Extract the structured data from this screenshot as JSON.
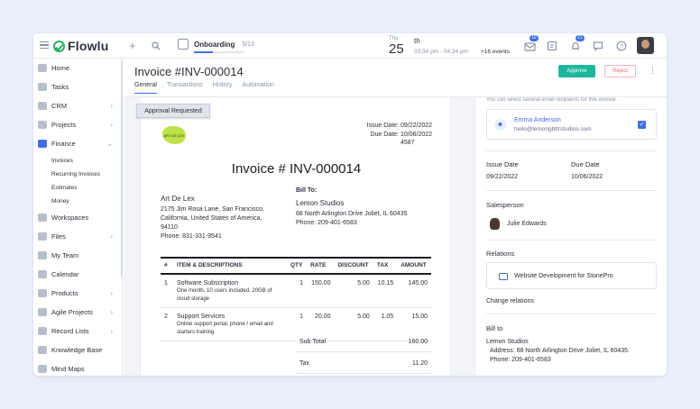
{
  "app": {
    "name": "Flowlu"
  },
  "topbar": {
    "onboarding_label": "Onboarding",
    "onboarding_count": "5/13",
    "onboarding_progress": 0.38,
    "date_dow": "Thu",
    "date_day": "25",
    "date_suffix": "th",
    "date_time": "03:34 pm - 04:34 pm",
    "date_events": "+16 events",
    "mail_badge": "10",
    "bell_badge": "21",
    "icons": [
      "plus-icon",
      "search-icon",
      "mail-icon",
      "notes-icon",
      "bell-icon",
      "chat-icon",
      "help-icon"
    ]
  },
  "sidebar": {
    "items": [
      {
        "label": "Home",
        "chevron": false
      },
      {
        "label": "Tasks",
        "chevron": false
      },
      {
        "label": "CRM",
        "chevron": true
      },
      {
        "label": "Projects",
        "chevron": true
      },
      {
        "label": "Finance",
        "chevron": true,
        "active": true
      },
      {
        "label": "Workspaces",
        "chevron": false
      },
      {
        "label": "Files",
        "chevron": true
      },
      {
        "label": "My Team",
        "chevron": false
      },
      {
        "label": "Calendar",
        "chevron": false
      },
      {
        "label": "Products",
        "chevron": true
      },
      {
        "label": "Agile Projects",
        "chevron": true
      },
      {
        "label": "Record Lists",
        "chevron": true
      },
      {
        "label": "Knowledge Base",
        "chevron": false
      },
      {
        "label": "Mind Maps",
        "chevron": false
      }
    ],
    "finance_sub": [
      "Invoices",
      "Recurring Invoices",
      "Estimates",
      "Money"
    ]
  },
  "header": {
    "title": "Invoice #INV-000014",
    "tabs": [
      "General",
      "Transactions",
      "History",
      "Automation"
    ],
    "approve_label": "Approve",
    "reject_label": "Reject"
  },
  "invoice": {
    "approval_status": "Approval Requested",
    "stamp_text": "ART DE LEX",
    "issue_date_label": "Issue Date:",
    "issue_date": "09/22/2022",
    "due_date_label": "Due Date:",
    "due_date": "10/06/2022",
    "ref": "4587",
    "number": "Invoice # INV-000014",
    "from": {
      "name": "Art De Lex",
      "address": "2175 Jim Rosa Lane, San Francisco, California, United States of America, 94110",
      "phone": "Phone: 831-331-9541"
    },
    "bill_to": {
      "heading": "Bill To:",
      "name": "Lemon Studios",
      "address": "68 North Arlington Drive Joliet, IL 60435",
      "phone": "Phone: 209-401-6583"
    },
    "columns": [
      "#",
      "ITEM & DESCRIPTIONS",
      "QTY",
      "RATE",
      "DISCOUNT",
      "TAX",
      "AMOUNT"
    ],
    "items": [
      {
        "n": "1",
        "title": "Software Subscription",
        "desc": "One month, 10 users included, 20GB of cloud storage",
        "qty": "1",
        "rate": "150.00",
        "discount": "5.00",
        "tax": "10.15",
        "amount": "145.00"
      },
      {
        "n": "2",
        "title": "Support Services",
        "desc": "Online support portal, phone / email and starters training",
        "qty": "1",
        "rate": "20.00",
        "discount": "5.00",
        "tax": "1.05",
        "amount": "15.00"
      }
    ],
    "subtotal_label": "Sub Total",
    "subtotal": "160.00",
    "tax_label": "Tax",
    "tax": "11.20"
  },
  "details": {
    "recipients_hint": "You can select several email recipients for this invoice.",
    "recipient_name": "Emma Anderson",
    "recipient_email": "hello@lemongbttrstudios.com",
    "issue_date_label": "Issue Date",
    "issue_date": "09/22/2022",
    "due_date_label": "Due Date",
    "due_date": "10/06/2022",
    "salesperson_label": "Salesperson",
    "salesperson": "Julie Edwards",
    "relations_label": "Relations",
    "relation": "Website Development for StonePro",
    "change_relations": "Change relations",
    "bill_to_label": "Bill to",
    "bill_to_name": "Lemon Studios",
    "bill_to_address": "Address: 68 North Arlington Drive Joliet, IL 60435",
    "bill_to_phone": "Phone: 209-401-6583"
  }
}
